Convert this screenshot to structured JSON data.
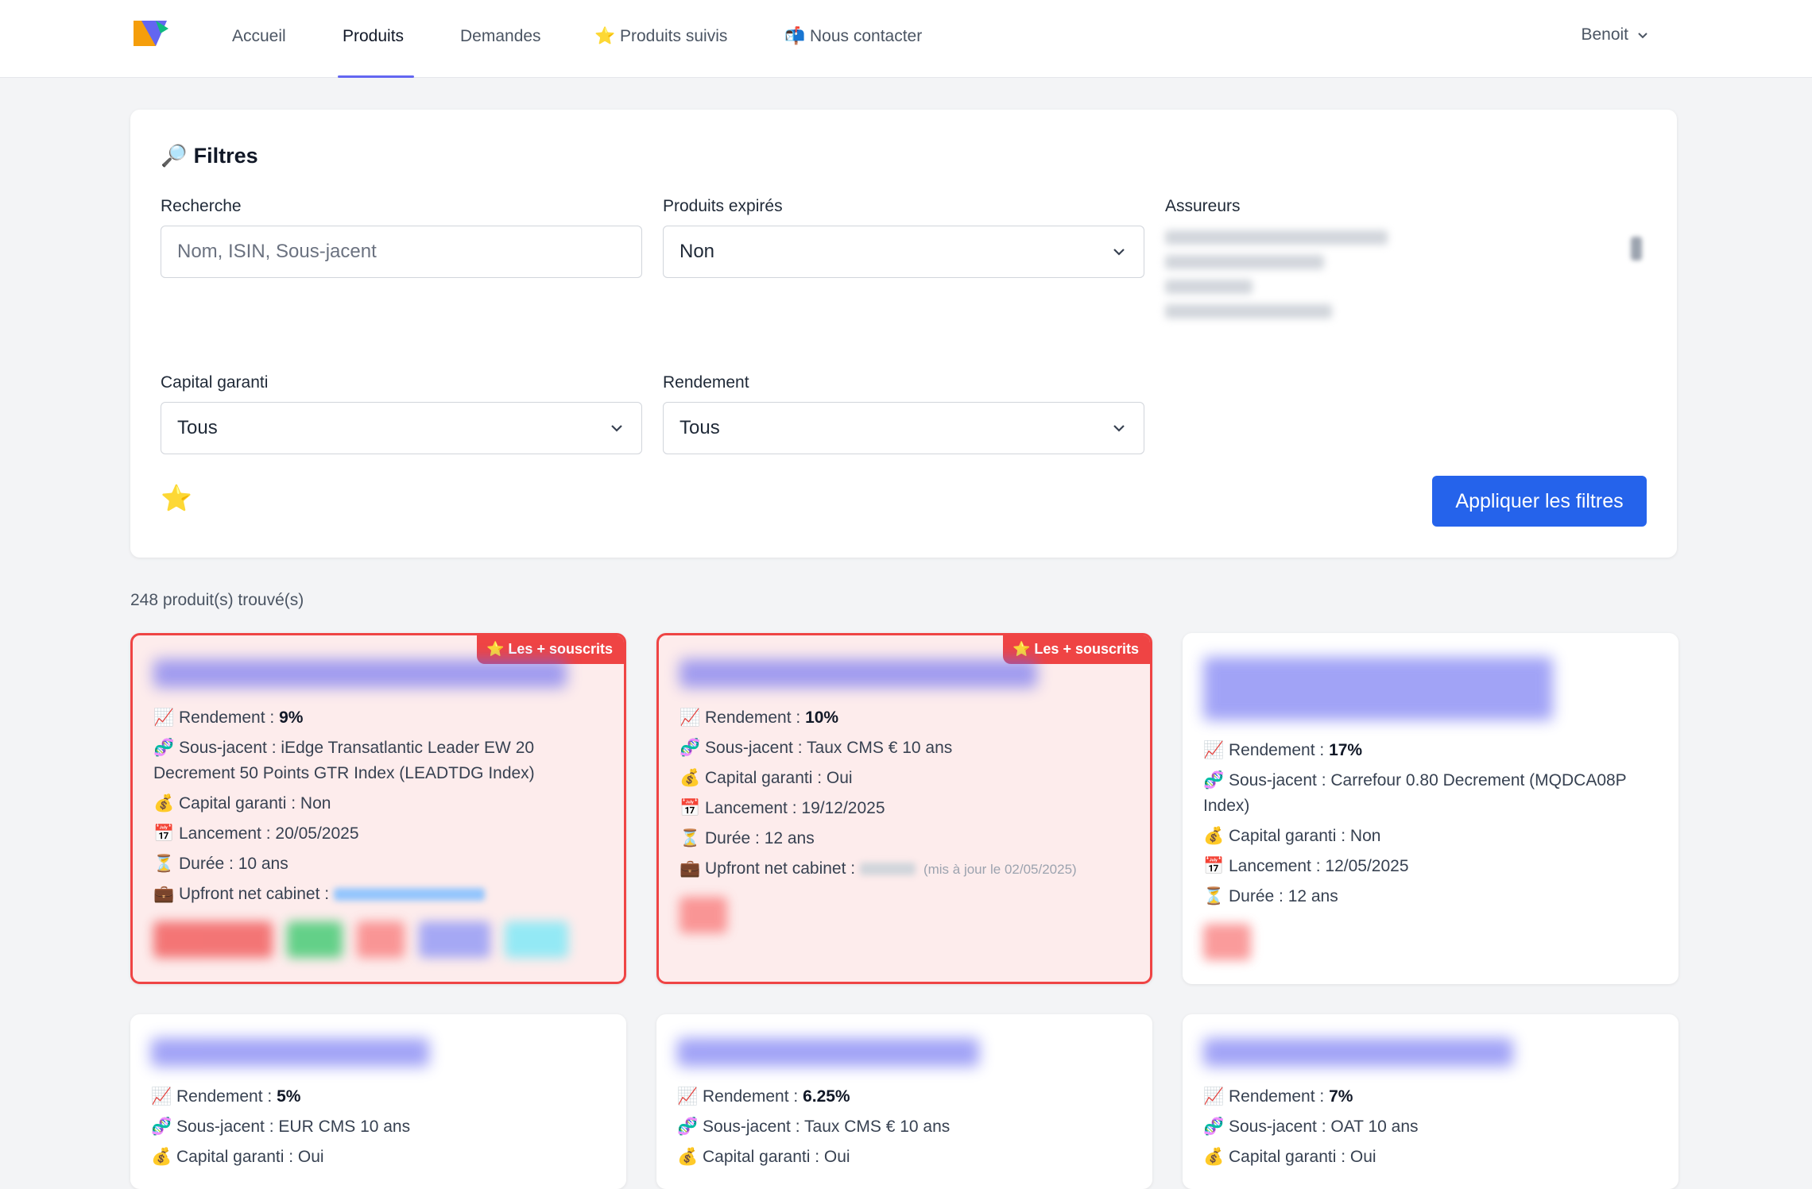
{
  "nav": {
    "items": [
      "Accueil",
      "Produits",
      "Demandes",
      "⭐ Produits suivis",
      "📬 Nous contacter"
    ],
    "user": "Benoit"
  },
  "filters": {
    "title": "Filtres",
    "search_label": "Recherche",
    "search_placeholder": "Nom, ISIN, Sous-jacent",
    "expired_label": "Produits expirés",
    "expired_value": "Non",
    "insurers_label": "Assureurs",
    "capital_label": "Capital garanti",
    "capital_value": "Tous",
    "yield_label": "Rendement",
    "yield_value": "Tous",
    "apply_label": "Appliquer les filtres"
  },
  "result_count": "248 produit(s) trouvé(s)",
  "badge_label": "⭐ Les + souscrits",
  "cards": [
    {
      "rendement": "9%",
      "sous_jacent": "iEdge Transatlantic Leader EW 20 Decrement 50 Points GTR Index (LEADTDG Index)",
      "capital": "Non",
      "lancement": "20/05/2025",
      "duree": "10 ans"
    },
    {
      "rendement": "10%",
      "sous_jacent": "Taux CMS € 10 ans",
      "capital": "Oui",
      "lancement": "19/12/2025",
      "duree": "12 ans",
      "upfront_note": "(mis à jour le 02/05/2025)"
    },
    {
      "rendement": "17%",
      "sous_jacent": "Carrefour 0.80 Decrement (MQDCA08P Index)",
      "capital": "Non",
      "lancement": "12/05/2025",
      "duree": "12 ans"
    },
    {
      "rendement": "5%",
      "sous_jacent": "EUR CMS 10 ans",
      "capital": "Oui"
    },
    {
      "rendement": "6.25%",
      "sous_jacent": "Taux CMS € 10 ans",
      "capital": "Oui"
    },
    {
      "rendement": "7%",
      "sous_jacent": "OAT 10 ans",
      "capital": "Oui"
    }
  ],
  "labels": {
    "rendement": "📈 Rendement : ",
    "sous_jacent": "🧬 Sous-jacent : ",
    "capital": "💰 Capital garanti : ",
    "lancement": "📅 Lancement : ",
    "duree": "⏳ Durée : ",
    "upfront": "💼 Upfront net cabinet : "
  }
}
